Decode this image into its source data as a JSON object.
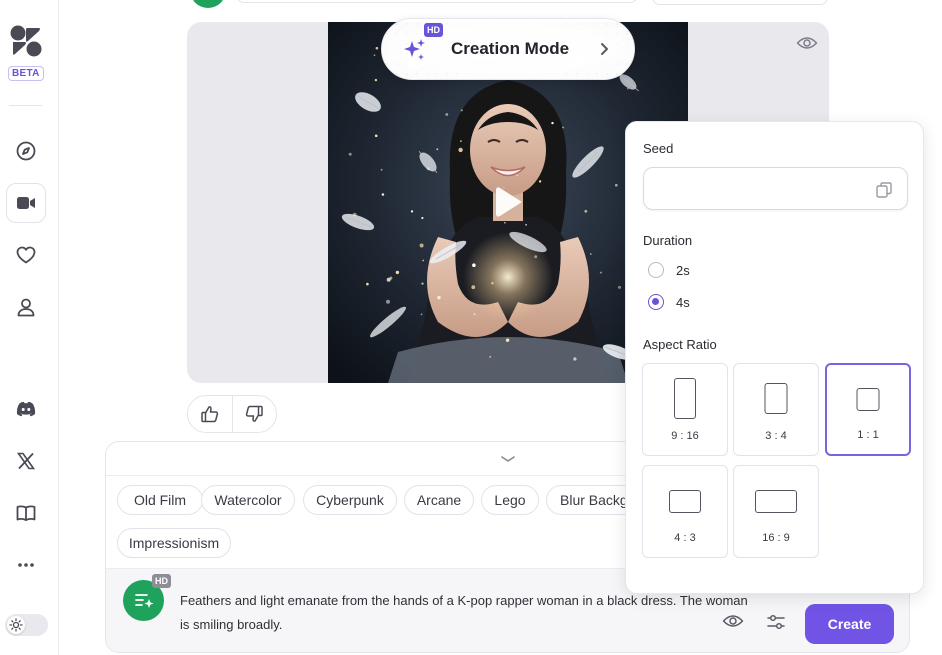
{
  "sidebar": {
    "badge": "BETA",
    "nav": [
      {
        "icon": "compass-icon"
      },
      {
        "icon": "video-camera-icon"
      },
      {
        "icon": "heart-icon"
      },
      {
        "icon": "user-icon"
      },
      {
        "icon": "discord-icon"
      },
      {
        "icon": "x-logo-icon"
      },
      {
        "icon": "book-icon"
      },
      {
        "icon": "more-icon"
      }
    ],
    "theme_toggle_icon": "sun-icon"
  },
  "media": {
    "mode_badge": "HD",
    "mode_label": "Creation Mode",
    "play_icon": "play-icon",
    "visibility_icon": "eye-icon"
  },
  "feedback": {
    "like_icon": "thumbs-up-icon",
    "dislike_icon": "thumbs-down-icon"
  },
  "composer": {
    "styles": [
      "Old Film",
      "Watercolor",
      "Cyberpunk",
      "Arcane",
      "Lego",
      "Blur Backg",
      "Impressionism"
    ],
    "prompt_badge": "HD",
    "prompt": "Feathers and light emanate from the hands of a K-pop rapper woman in a black dress. The woman is smiling broadly.",
    "create_label": "Create"
  },
  "settings": {
    "seed_label": "Seed",
    "seed_value": "",
    "duration_label": "Duration",
    "durations": [
      {
        "label": "2s",
        "selected": false
      },
      {
        "label": "4s",
        "selected": true
      }
    ],
    "aspect_label": "Aspect Ratio",
    "aspects": [
      {
        "label": "9 : 16",
        "selected": false
      },
      {
        "label": "3 : 4",
        "selected": false
      },
      {
        "label": "1 : 1",
        "selected": true
      },
      {
        "label": "4 : 3",
        "selected": false
      },
      {
        "label": "16 : 9",
        "selected": false
      }
    ]
  },
  "colors": {
    "accent": "#7154e6",
    "avatar_green": "#1fa35c",
    "selected_border": "#7a63e0"
  }
}
